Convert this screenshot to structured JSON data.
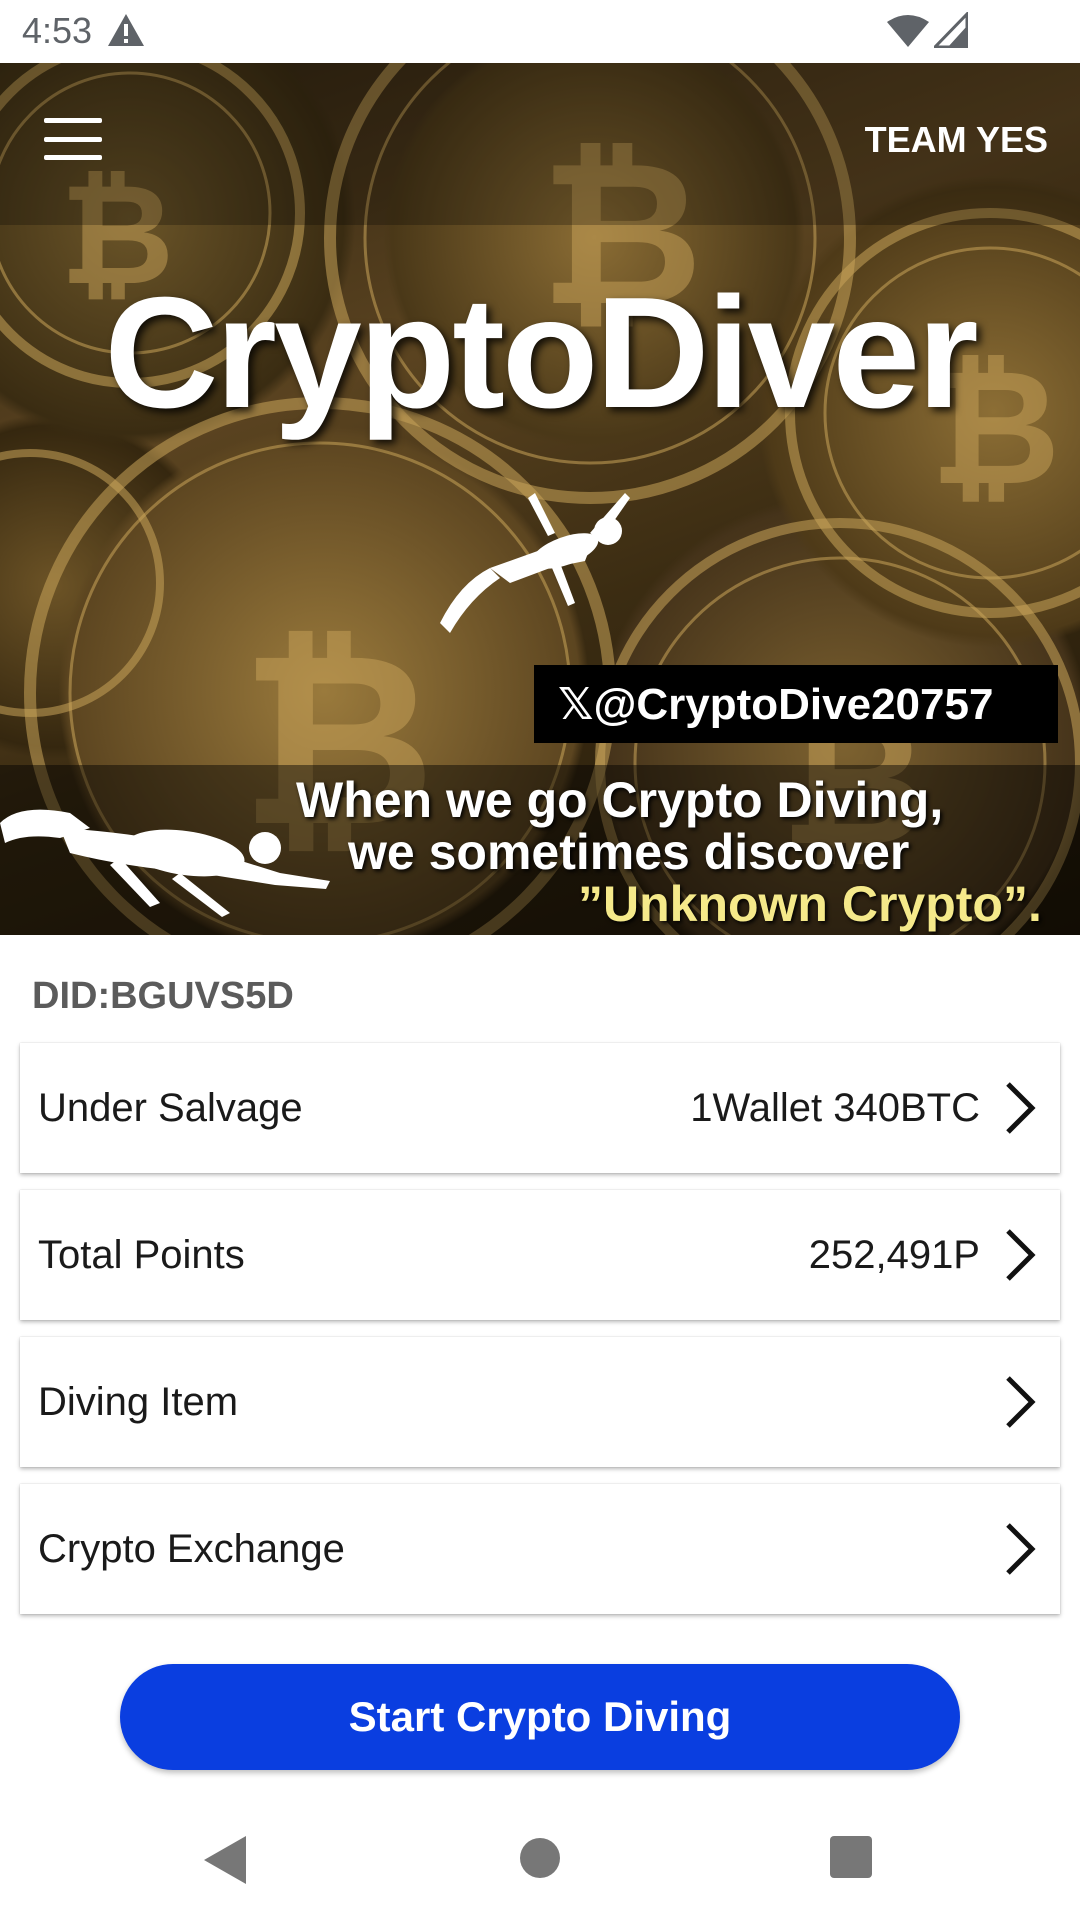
{
  "status_bar": {
    "time": "4:53",
    "icons": [
      "alert-icon",
      "wifi-icon",
      "signal-icon"
    ]
  },
  "header": {
    "menu_icon": "hamburger-menu-icon",
    "team_label": "TEAM YES"
  },
  "banner": {
    "title": "CryptoDiver",
    "handle": "𝕏@CryptoDive20757",
    "caption_line1": "When we go Crypto Diving,",
    "caption_line2": "we sometimes discover",
    "caption_line3": "”Unknown Crypto”."
  },
  "did": "DID:BGUVS5D",
  "menu_items": [
    {
      "label": "Under Salvage",
      "value": "1Wallet 340BTC"
    },
    {
      "label": "Total Points",
      "value": "252,491P"
    },
    {
      "label": "Diving Item",
      "value": ""
    },
    {
      "label": "Crypto Exchange",
      "value": ""
    }
  ],
  "start_button": {
    "label": "Start Crypto Diving"
  },
  "colors": {
    "accent": "#0a3ee0",
    "status_text": "#5f6368",
    "did_text": "#5b5b5b",
    "caption_highlight": "#f5e98a"
  },
  "nav_bar": {
    "icons": [
      "back-icon",
      "home-icon",
      "recents-icon"
    ]
  }
}
